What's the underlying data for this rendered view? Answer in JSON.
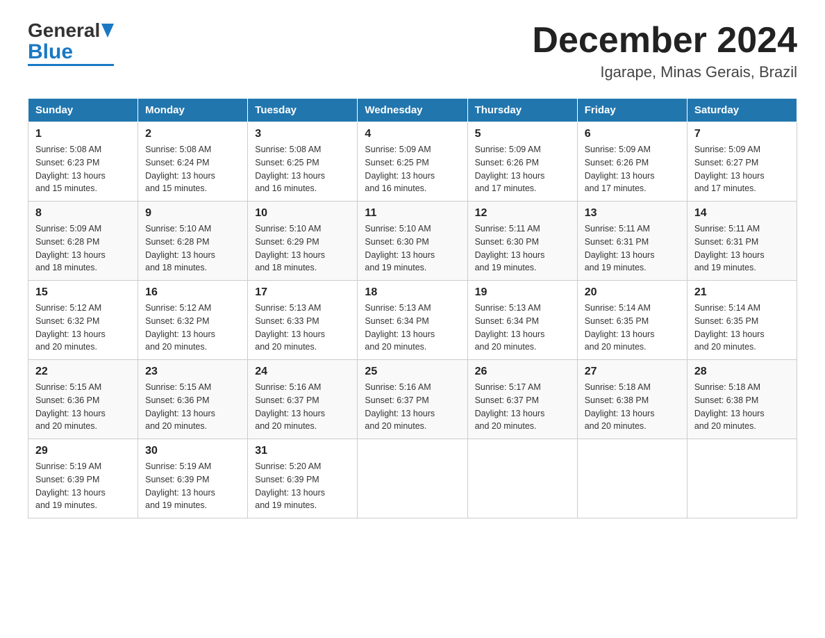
{
  "logo": {
    "general": "General",
    "blue": "Blue"
  },
  "title": "December 2024",
  "subtitle": "Igarape, Minas Gerais, Brazil",
  "days_header": [
    "Sunday",
    "Monday",
    "Tuesday",
    "Wednesday",
    "Thursday",
    "Friday",
    "Saturday"
  ],
  "weeks": [
    [
      {
        "day": "1",
        "sunrise": "5:08 AM",
        "sunset": "6:23 PM",
        "daylight": "13 hours and 15 minutes."
      },
      {
        "day": "2",
        "sunrise": "5:08 AM",
        "sunset": "6:24 PM",
        "daylight": "13 hours and 15 minutes."
      },
      {
        "day": "3",
        "sunrise": "5:08 AM",
        "sunset": "6:25 PM",
        "daylight": "13 hours and 16 minutes."
      },
      {
        "day": "4",
        "sunrise": "5:09 AM",
        "sunset": "6:25 PM",
        "daylight": "13 hours and 16 minutes."
      },
      {
        "day": "5",
        "sunrise": "5:09 AM",
        "sunset": "6:26 PM",
        "daylight": "13 hours and 17 minutes."
      },
      {
        "day": "6",
        "sunrise": "5:09 AM",
        "sunset": "6:26 PM",
        "daylight": "13 hours and 17 minutes."
      },
      {
        "day": "7",
        "sunrise": "5:09 AM",
        "sunset": "6:27 PM",
        "daylight": "13 hours and 17 minutes."
      }
    ],
    [
      {
        "day": "8",
        "sunrise": "5:09 AM",
        "sunset": "6:28 PM",
        "daylight": "13 hours and 18 minutes."
      },
      {
        "day": "9",
        "sunrise": "5:10 AM",
        "sunset": "6:28 PM",
        "daylight": "13 hours and 18 minutes."
      },
      {
        "day": "10",
        "sunrise": "5:10 AM",
        "sunset": "6:29 PM",
        "daylight": "13 hours and 18 minutes."
      },
      {
        "day": "11",
        "sunrise": "5:10 AM",
        "sunset": "6:30 PM",
        "daylight": "13 hours and 19 minutes."
      },
      {
        "day": "12",
        "sunrise": "5:11 AM",
        "sunset": "6:30 PM",
        "daylight": "13 hours and 19 minutes."
      },
      {
        "day": "13",
        "sunrise": "5:11 AM",
        "sunset": "6:31 PM",
        "daylight": "13 hours and 19 minutes."
      },
      {
        "day": "14",
        "sunrise": "5:11 AM",
        "sunset": "6:31 PM",
        "daylight": "13 hours and 19 minutes."
      }
    ],
    [
      {
        "day": "15",
        "sunrise": "5:12 AM",
        "sunset": "6:32 PM",
        "daylight": "13 hours and 20 minutes."
      },
      {
        "day": "16",
        "sunrise": "5:12 AM",
        "sunset": "6:32 PM",
        "daylight": "13 hours and 20 minutes."
      },
      {
        "day": "17",
        "sunrise": "5:13 AM",
        "sunset": "6:33 PM",
        "daylight": "13 hours and 20 minutes."
      },
      {
        "day": "18",
        "sunrise": "5:13 AM",
        "sunset": "6:34 PM",
        "daylight": "13 hours and 20 minutes."
      },
      {
        "day": "19",
        "sunrise": "5:13 AM",
        "sunset": "6:34 PM",
        "daylight": "13 hours and 20 minutes."
      },
      {
        "day": "20",
        "sunrise": "5:14 AM",
        "sunset": "6:35 PM",
        "daylight": "13 hours and 20 minutes."
      },
      {
        "day": "21",
        "sunrise": "5:14 AM",
        "sunset": "6:35 PM",
        "daylight": "13 hours and 20 minutes."
      }
    ],
    [
      {
        "day": "22",
        "sunrise": "5:15 AM",
        "sunset": "6:36 PM",
        "daylight": "13 hours and 20 minutes."
      },
      {
        "day": "23",
        "sunrise": "5:15 AM",
        "sunset": "6:36 PM",
        "daylight": "13 hours and 20 minutes."
      },
      {
        "day": "24",
        "sunrise": "5:16 AM",
        "sunset": "6:37 PM",
        "daylight": "13 hours and 20 minutes."
      },
      {
        "day": "25",
        "sunrise": "5:16 AM",
        "sunset": "6:37 PM",
        "daylight": "13 hours and 20 minutes."
      },
      {
        "day": "26",
        "sunrise": "5:17 AM",
        "sunset": "6:37 PM",
        "daylight": "13 hours and 20 minutes."
      },
      {
        "day": "27",
        "sunrise": "5:18 AM",
        "sunset": "6:38 PM",
        "daylight": "13 hours and 20 minutes."
      },
      {
        "day": "28",
        "sunrise": "5:18 AM",
        "sunset": "6:38 PM",
        "daylight": "13 hours and 20 minutes."
      }
    ],
    [
      {
        "day": "29",
        "sunrise": "5:19 AM",
        "sunset": "6:39 PM",
        "daylight": "13 hours and 19 minutes."
      },
      {
        "day": "30",
        "sunrise": "5:19 AM",
        "sunset": "6:39 PM",
        "daylight": "13 hours and 19 minutes."
      },
      {
        "day": "31",
        "sunrise": "5:20 AM",
        "sunset": "6:39 PM",
        "daylight": "13 hours and 19 minutes."
      },
      null,
      null,
      null,
      null
    ]
  ],
  "colors": {
    "header_bg": "#2176ae",
    "header_text": "#ffffff",
    "border": "#cccccc"
  },
  "labels": {
    "sunrise": "Sunrise:",
    "sunset": "Sunset:",
    "daylight": "Daylight:"
  }
}
